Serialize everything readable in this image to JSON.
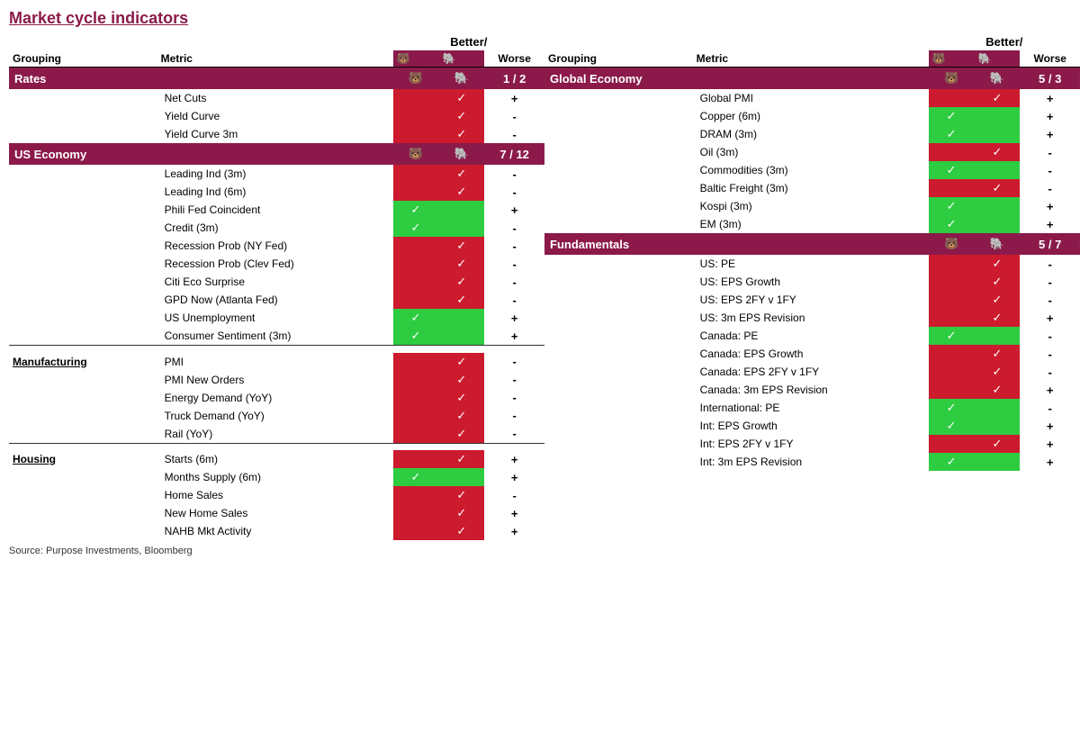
{
  "title": "Market cycle indicators",
  "source": "Source: Purpose Investments, Bloomberg",
  "headers": {
    "better_worse_top": "Better/",
    "grouping": "Grouping",
    "metric": "Metric",
    "worse": "Worse"
  },
  "left": {
    "sections": [
      {
        "name": "Rates",
        "score": "1 / 2",
        "rows": [
          {
            "metric": "Net Cuts",
            "bear": false,
            "bull": true,
            "bw": "+"
          },
          {
            "metric": "Yield Curve",
            "bear": false,
            "bull": true,
            "bw": "-"
          },
          {
            "metric": "Yield Curve 3m",
            "bear": false,
            "bull": true,
            "bw": "-"
          }
        ]
      },
      {
        "name": "US Economy",
        "score": "7 / 12",
        "rows": [
          {
            "metric": "Leading Ind (3m)",
            "bear": false,
            "bull": true,
            "bw": "-"
          },
          {
            "metric": "Leading Ind (6m)",
            "bear": false,
            "bull": true,
            "bw": "-"
          },
          {
            "metric": "Phili Fed Coincident",
            "bear": true,
            "bull": false,
            "bw": "+"
          },
          {
            "metric": "Credit (3m)",
            "bear": true,
            "bull": false,
            "bw": "-"
          },
          {
            "metric": "Recession Prob (NY Fed)",
            "bear": false,
            "bull": true,
            "bw": "-"
          },
          {
            "metric": "Recession Prob (Clev Fed)",
            "bear": false,
            "bull": true,
            "bw": "-"
          },
          {
            "metric": "Citi Eco Surprise",
            "bear": false,
            "bull": true,
            "bw": "-"
          },
          {
            "metric": "GPD Now (Atlanta Fed)",
            "bear": false,
            "bull": true,
            "bw": "-"
          },
          {
            "metric": "US Unemployment",
            "bear": true,
            "bull": false,
            "bw": "+"
          },
          {
            "metric": "Consumer Sentiment (3m)",
            "bear": true,
            "bull": false,
            "bw": "+"
          }
        ]
      }
    ],
    "standalone_sections": [
      {
        "name": "Manufacturing",
        "rows": [
          {
            "metric": "PMI",
            "bear": false,
            "bull": true,
            "bw": "-"
          },
          {
            "metric": "PMI New Orders",
            "bear": false,
            "bull": true,
            "bw": "-"
          },
          {
            "metric": "Energy Demand (YoY)",
            "bear": false,
            "bull": true,
            "bw": "-"
          },
          {
            "metric": "Truck Demand (YoY)",
            "bear": false,
            "bull": true,
            "bw": "-"
          },
          {
            "metric": "Rail (YoY)",
            "bear": false,
            "bull": true,
            "bw": "-"
          }
        ]
      },
      {
        "name": "Housing",
        "rows": [
          {
            "metric": "Starts (6m)",
            "bear": false,
            "bull": true,
            "bw": "+"
          },
          {
            "metric": "Months Supply (6m)",
            "bear": true,
            "bull": false,
            "bw": "+"
          },
          {
            "metric": "Home Sales",
            "bear": false,
            "bull": true,
            "bw": "-"
          },
          {
            "metric": "New Home Sales",
            "bear": false,
            "bull": true,
            "bw": "+"
          },
          {
            "metric": "NAHB Mkt Activity",
            "bear": false,
            "bull": true,
            "bw": "+"
          }
        ]
      }
    ]
  },
  "right": {
    "sections": [
      {
        "name": "Global Economy",
        "score": "5 / 3",
        "rows": [
          {
            "metric": "Global PMI",
            "bear": false,
            "bull": true,
            "bw": "+"
          },
          {
            "metric": "Copper (6m)",
            "bear": true,
            "bull": false,
            "bw": "+"
          },
          {
            "metric": "DRAM (3m)",
            "bear": true,
            "bull": false,
            "bw": "+"
          },
          {
            "metric": "Oil (3m)",
            "bear": false,
            "bull": true,
            "bw": "-"
          },
          {
            "metric": "Commodities (3m)",
            "bear": true,
            "bull": false,
            "bw": "-"
          },
          {
            "metric": "Baltic Freight (3m)",
            "bear": false,
            "bull": true,
            "bw": "-"
          },
          {
            "metric": "Kospi (3m)",
            "bear": true,
            "bull": false,
            "bw": "+"
          },
          {
            "metric": "EM (3m)",
            "bear": true,
            "bull": false,
            "bw": "+"
          }
        ]
      },
      {
        "name": "Fundamentals",
        "score": "5 / 7",
        "rows": [
          {
            "metric": "US: PE",
            "bear": false,
            "bull": true,
            "bw": "-"
          },
          {
            "metric": "US: EPS Growth",
            "bear": false,
            "bull": true,
            "bw": "-"
          },
          {
            "metric": "US: EPS 2FY v 1FY",
            "bear": false,
            "bull": true,
            "bw": "-"
          },
          {
            "metric": "US: 3m EPS Revision",
            "bear": false,
            "bull": true,
            "bw": "+"
          },
          {
            "metric": "Canada: PE",
            "bear": true,
            "bull": false,
            "bw": "-"
          },
          {
            "metric": "Canada: EPS Growth",
            "bear": false,
            "bull": true,
            "bw": "-"
          },
          {
            "metric": "Canada: EPS 2FY v 1FY",
            "bear": false,
            "bull": true,
            "bw": "-"
          },
          {
            "metric": "Canada: 3m EPS Revision",
            "bear": false,
            "bull": true,
            "bw": "+"
          },
          {
            "metric": "International: PE",
            "bear": true,
            "bull": false,
            "bw": "-"
          },
          {
            "metric": "Int: EPS Growth",
            "bear": true,
            "bull": false,
            "bw": "+"
          },
          {
            "metric": "Int: EPS 2FY v 1FY",
            "bear": false,
            "bull": true,
            "bw": "+"
          },
          {
            "metric": "Int: 3m EPS Revision",
            "bear": true,
            "bull": false,
            "bw": "+"
          }
        ]
      }
    ]
  }
}
